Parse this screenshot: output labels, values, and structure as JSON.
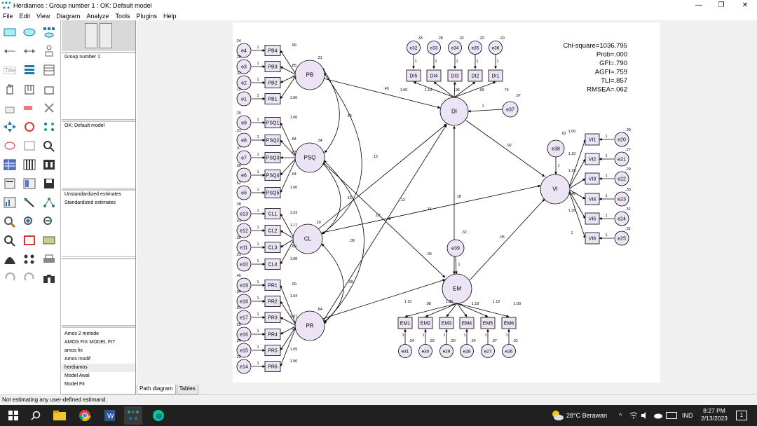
{
  "window": {
    "title": "Herdiamos : Group number 1 : OK: Default model",
    "controls": [
      "—",
      "❐",
      "✕"
    ]
  },
  "menu": [
    "File",
    "Edit",
    "View",
    "Diagram",
    "Analyze",
    "Tools",
    "Plugins",
    "Help"
  ],
  "toolbox": {
    "title_button": "Title"
  },
  "panels": {
    "groups": [
      "Group number 1"
    ],
    "models": [
      "OK: Default model"
    ],
    "estimates": [
      "Unstandardized estimates",
      "Standardized estimates"
    ],
    "files": [
      "Amos 2 metode",
      "AMOS FIX MODEL FIT",
      "amos fix",
      "Amos modif",
      "herdiamos",
      "Model Awal",
      "Model Fit"
    ],
    "files_selected": "herdiamos"
  },
  "fit_stats": [
    "Chi-square=1036.795",
    "Prob=.000",
    "GFI=.790",
    "AGFI=.759",
    "TLI=.857",
    "RMSEA=.062"
  ],
  "diagram": {
    "latents": [
      {
        "id": "PB",
        "label": "PB",
        "var": ".21"
      },
      {
        "id": "PSQ",
        "label": "PSQ",
        "var": ".34"
      },
      {
        "id": "CL",
        "label": "CL",
        "var": ".20"
      },
      {
        "id": "PR",
        "label": "PR",
        "var": ".84"
      },
      {
        "id": "DI",
        "label": "DI",
        "var": ".07"
      },
      {
        "id": "VI",
        "label": "VI",
        "var": ".02"
      },
      {
        "id": "EM",
        "label": "EM",
        "var": ".32"
      }
    ],
    "left_indicators": [
      {
        "e": "e4",
        "ev": ".24",
        "ind": "PB4",
        "load": ".99"
      },
      {
        "e": "e3",
        "ev": ".28",
        "ind": "PB3",
        "load": ".85"
      },
      {
        "e": "e2",
        "ev": ".32",
        "ind": "PB2",
        "load": ".75"
      },
      {
        "e": "e1",
        "ev": ".15",
        "ind": "PB1",
        "load": "1.00"
      },
      {
        "e": "e9",
        "ev": ".20",
        "ind": "PSQ1",
        "load": "1.00"
      },
      {
        "e": "e8",
        "ev": ".31",
        "ind": "PSQ2",
        "load": ".84"
      },
      {
        "e": "e7",
        "ev": ".37",
        "ind": "PSQ3",
        "load": ".63"
      },
      {
        "e": "e6",
        "ev": ".30",
        "ind": "PSQ4",
        "load": ".64"
      },
      {
        "e": "e5",
        "ev": ".52",
        "ind": "PSQ5",
        "load": "1.00"
      },
      {
        "e": "e13",
        "ev": ".28",
        "ind": "CL1",
        "load": "1.23"
      },
      {
        "e": "e12",
        "ev": ".41",
        "ind": "CL2",
        "load": "1.17"
      },
      {
        "e": "e11",
        "ev": ".30",
        "ind": "CL3",
        "load": ".89"
      },
      {
        "e": "e10",
        "ev": ".31",
        "ind": "CL4",
        "load": "1.00"
      },
      {
        "e": "e19",
        "ev": ".45",
        "ind": "PR1",
        "load": ".90"
      },
      {
        "e": "e18",
        "ev": ".54",
        "ind": "PR2",
        "load": "1.04"
      },
      {
        "e": "e17",
        "ev": ".61",
        "ind": "PR3",
        "load": "1.01"
      },
      {
        "e": "e16",
        "ev": ".55",
        "ind": "PR4",
        "load": ".91"
      },
      {
        "e": "e15",
        "ev": ".34",
        "ind": "PR5",
        "load": "1.05"
      },
      {
        "e": "e14",
        "ev": ".22",
        "ind": "PR6",
        "load": "1.00"
      }
    ],
    "di_indicators": [
      {
        "e": "e32",
        "ev": ".33",
        "ind": "DI5",
        "load": "1.00"
      },
      {
        "e": "e33",
        "ev": ".28",
        "ind": "DI4",
        "load": "1.13"
      },
      {
        "e": "e34",
        "ev": ".32",
        "ind": "DI3",
        "load": ".95"
      },
      {
        "e": "e35",
        "ev": ".32",
        "ind": "DI2",
        "load": ".99"
      },
      {
        "e": "e36",
        "ev": ".20",
        "ind": "DI1",
        "load": ".74"
      }
    ],
    "vi_indicators": [
      {
        "e": "e20",
        "ev": ".30",
        "ind": "VI1",
        "load": "1.00"
      },
      {
        "e": "e21",
        "ev": ".27",
        "ind": "VI2",
        "load": "1.10"
      },
      {
        "e": "e22",
        "ev": ".29",
        "ind": "VI3",
        "load": "1.25"
      },
      {
        "e": "e23",
        "ev": ".33",
        "ind": "VI4",
        "load": "1.40"
      },
      {
        "e": "e24",
        "ev": ".31",
        "ind": "VI5",
        "load": "1.35"
      },
      {
        "e": "e25",
        "ev": ".31",
        "ind": "VI6",
        "load": "1"
      }
    ],
    "em_indicators": [
      {
        "e": "e31",
        "ev": ".34",
        "ind": "EM1",
        "load": "1.10"
      },
      {
        "e": "e30",
        "ev": ".29",
        "ind": "EM2",
        "load": ".98"
      },
      {
        "e": "e29",
        "ev": ".20",
        "ind": "EM3",
        "load": "1.26"
      },
      {
        "e": "e28",
        "ev": ".24",
        "ind": "EM4",
        "load": "1.18"
      },
      {
        "e": "e27",
        "ev": ".37",
        "ind": "EM5",
        "load": "1.12"
      },
      {
        "e": "e26",
        "ev": ".01",
        "ind": "EM6",
        "load": "1.00"
      }
    ],
    "structural": {
      "PB_DI": ".45",
      "PB_PSQ": ".15",
      "PB_CL": ".13",
      "PSQ_CL": ".15",
      "PSQ_EM": ".48",
      "CL_VI": ".16",
      "CL_DI": ".12",
      "PR_EM": ".09",
      "PSQ_PR": ".07",
      "CL_PR": ".09",
      "DI_VI": ".92",
      "EM_DI": ".18",
      "EM_VI": ".05",
      "e39_EM": ".06"
    },
    "disturbances": [
      {
        "e": "e37",
        "to": "DI"
      },
      {
        "e": "e38",
        "to": "VI"
      },
      {
        "e": "e39",
        "to": "EM"
      }
    ]
  },
  "tabs": [
    "Path diagram",
    "Tables"
  ],
  "status": "Not estimating any user-defined estimand.",
  "taskbar": {
    "weather": "28°C Berawan",
    "lang": "IND",
    "time": "8:27 PM",
    "date": "2/13/2023",
    "notifications": "1"
  }
}
